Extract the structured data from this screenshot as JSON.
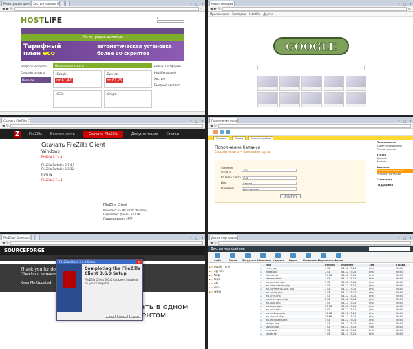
{
  "q1": {
    "tabs": [
      "Регистрация домено…",
      "Хостинг сайтов, Виртуал…",
      "",
      "",
      "",
      ""
    ],
    "logo_a": "HOST",
    "logo_b": "LIFE",
    "nav_text": "Регистрация доменов",
    "banner_left_1": "Тарифный",
    "banner_left_2": "план",
    "banner_left_badge": "eco",
    "banner_right_1": "автоматическая установка",
    "banner_right_2": "более 50 скриптов",
    "side_items": [
      "Вопросы и ответы",
      "Способы оплаты",
      "Новости"
    ],
    "main_title": "Популярные услуги",
    "cards": [
      {
        "label": "«Google»",
        "price": "от 61,47"
      },
      {
        "label": "«Бизнес»",
        "price": "от 61,25"
      },
      {
        "label": "«CEO»",
        "price": ""
      },
      {
        "label": "«Старт»",
        "price": ""
      }
    ],
    "right_items": [
      "Новые платформы",
      "Hostlife support",
      "Хостинг",
      "Быстрый контакт"
    ]
  },
  "q2": {
    "tabs": [
      "Новая вкладка"
    ],
    "bookmarks": [
      "Приложения",
      "Закладки",
      "Hostlife",
      "Другое"
    ],
    "doodle_text": "GOOGLE",
    "thumbs": [
      "",
      "",
      "",
      "",
      "",
      "",
      "",
      "",
      "",
      ""
    ]
  },
  "q3": {
    "tabs": [
      "Скачать FileZilla Client"
    ],
    "nav": [
      "FileZilla",
      "Возможности",
      "Скачать FileZilla",
      "Документация",
      "Статьи"
    ],
    "download_btn": "Скачать FileZilla",
    "page_title": "Скачать FileZilla Client",
    "windows": "Windows",
    "windows_ver": "FileZilla 3.7.4.1",
    "portable": "FileZilla Portable 3.7.4.1",
    "portable2": "FileZilla Portable 3.3.32",
    "linux": "Linux",
    "linux_ver": "FileZilla 3.7.4.1",
    "card_title": "FileZilla Client",
    "card_lines": [
      "Работает на Microsoft Windows",
      "Переводит файлы на FTP",
      "Поддерживает SFTP"
    ]
  },
  "q4": {
    "tabs": [
      "Пополнение баланса"
    ],
    "yellow_btns": [
      "Справка",
      "Выход",
      "Мои настройки"
    ],
    "title": "Пополнение баланса",
    "sub": "Способы оплаты — Банковские карты",
    "form": [
      {
        "label": "Сумма к оплате",
        "value": "100"
      },
      {
        "label": "Валюта счета",
        "value": "RUB"
      },
      {
        "label": "Имя",
        "value": "Сергей"
      },
      {
        "label": "Фамилия",
        "value": "Дмитриенко"
      }
    ],
    "pay": "Оплатить",
    "side": [
      {
        "text": "Пользователь",
        "head": true
      },
      {
        "text": "Клиентские данные",
        "head": false
      },
      {
        "text": "Личные данные",
        "head": false
      },
      {
        "text": "Услуги",
        "head": true
      },
      {
        "text": "Домены",
        "head": false
      },
      {
        "text": "Хостинг",
        "head": false
      },
      {
        "text": "Финансы",
        "head": true
      },
      {
        "text": "Пополнение баланса",
        "head": false,
        "sel": true
      },
      {
        "text": "История платежей",
        "head": false
      },
      {
        "text": "Статистика",
        "head": true
      },
      {
        "text": "Поддержка",
        "head": true
      }
    ]
  },
  "q5": {
    "tabs": [
      "FileZilla / Downloads",
      "",
      "",
      ""
    ],
    "logo": "SOURCEFORGE",
    "dark_1": "Thank you for down…",
    "dark_2": "Checkout screensh…",
    "keep": "Keep Me Updated",
    "ad_1": "работать в одном",
    "ad_2": "документом.",
    "inst_title": "FileZilla Client 3.6.0 Setup",
    "inst_heading": "Completing the FileZilla Client 3.6.0 Setup",
    "inst_body": "FileZilla Client 3.6.0 has been installed on your computer.",
    "inst_btns": [
      "< Back",
      "Finish",
      "Cancel"
    ]
  },
  "q6": {
    "title": "Диспетчер файлов",
    "tools": [
      "Файл",
      "Папка",
      "Загрузить",
      "Изменить",
      "Удалить",
      "Права",
      "Копировать",
      "Переместить",
      "Архив"
    ],
    "tree": [
      "public_html",
      "cgi-bin",
      "tmp",
      "logs",
      "etc",
      "mail",
      "www"
    ],
    "headers": [
      "",
      "Имя",
      "Размер",
      "Изменен",
      "Тип",
      "Права"
    ],
    "rows": [
      [
        "▫",
        "error_log",
        "4 KB",
        "04-12 15:24",
        "text",
        "0644"
      ],
      [
        "▫",
        "index.php",
        "2 KB",
        "04-12 15:24",
        "php",
        "0644"
      ],
      [
        "▫",
        "license.txt",
        "19 KB",
        "04-12 15:24",
        "text",
        "0644"
      ],
      [
        "▫",
        "readme.html",
        "7 KB",
        "04-12 15:24",
        "html",
        "0644"
      ],
      [
        "▫",
        "wp-activate.php",
        "5 KB",
        "04-12 15:24",
        "php",
        "0644"
      ],
      [
        "▫",
        "wp-blog-header.php",
        "1 KB",
        "04-12 15:24",
        "php",
        "0644"
      ],
      [
        "▫",
        "wp-comments-post.php",
        "2 KB",
        "04-12 15:24",
        "php",
        "0644"
      ],
      [
        "▫",
        "wp-config.php",
        "3 KB",
        "04-12 15:24",
        "php",
        "0644"
      ],
      [
        "▫",
        "wp-cron.php",
        "3 KB",
        "04-12 15:24",
        "php",
        "0644"
      ],
      [
        "▫",
        "wp-links-opml.php",
        "2 KB",
        "04-12 15:24",
        "php",
        "0644"
      ],
      [
        "▫",
        "wp-load.php",
        "3 KB",
        "04-12 15:24",
        "php",
        "0644"
      ],
      [
        "▫",
        "wp-login.php",
        "33 KB",
        "04-12 15:24",
        "php",
        "0644"
      ],
      [
        "▫",
        "wp-mail.php",
        "8 KB",
        "04-12 15:24",
        "php",
        "0644"
      ],
      [
        "▫",
        "wp-settings.php",
        "11 KB",
        "04-12 15:24",
        "php",
        "0644"
      ],
      [
        "▫",
        "wp-signup.php",
        "25 KB",
        "04-12 15:24",
        "php",
        "0644"
      ],
      [
        "▫",
        "wp-trackback.php",
        "4 KB",
        "04-12 15:24",
        "php",
        "0644"
      ],
      [
        "▫",
        "xmlrpc.php",
        "3 KB",
        "04-12 15:24",
        "php",
        "0644"
      ],
      [
        "▫",
        "favicon.ico",
        "1 KB",
        "04-12 15:24",
        "icon",
        "0644"
      ],
      [
        "▫",
        ".htaccess",
        "1 KB",
        "04-12 15:24",
        "text",
        "0644"
      ],
      [
        "▫",
        "robots.txt",
        "1 KB",
        "04-12 15:24",
        "text",
        "0644"
      ]
    ]
  }
}
